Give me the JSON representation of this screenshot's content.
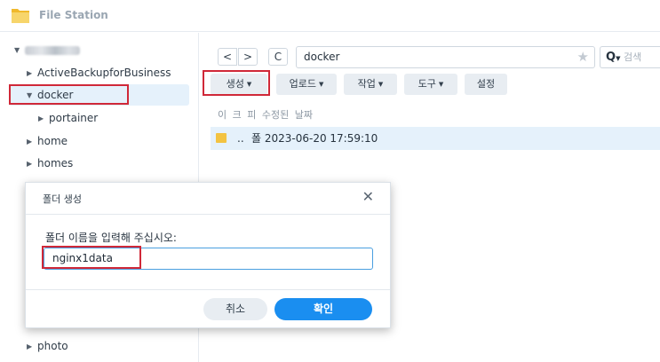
{
  "window": {
    "title": "File Station"
  },
  "sidebar": {
    "items": [
      {
        "label": "ActiveBackupforBusiness"
      },
      {
        "label": "docker"
      },
      {
        "label": "portainer"
      },
      {
        "label": "home"
      },
      {
        "label": "homes"
      },
      {
        "label": "photo"
      }
    ]
  },
  "toolbar": {
    "back_label": "<",
    "forward_label": ">",
    "refresh_label": "C",
    "path": "docker",
    "search_placeholder": "검색",
    "create_label": "생성",
    "upload_label": "업로드",
    "action_label": "작업",
    "tools_label": "도구",
    "settings_label": "설정"
  },
  "file_list": {
    "header": "이 크 피 수정된 날짜",
    "rows": [
      {
        "name": "..",
        "info": "폴 2023-06-20 17:59:10"
      }
    ]
  },
  "dialog": {
    "title": "폴더 생성",
    "prompt": "폴더 이름을 입력해 주십시오:",
    "input_value": "nginx1data",
    "cancel_label": "취소",
    "confirm_label": "확인"
  },
  "colors": {
    "accent": "#1a8ef0",
    "highlight_box": "#d02838",
    "selection": "#e5f1fb",
    "folder": "#f3c342"
  },
  "icons": {
    "app": "folder-icon",
    "favorite": "star-icon",
    "search": "search-icon",
    "close": "close-icon"
  }
}
